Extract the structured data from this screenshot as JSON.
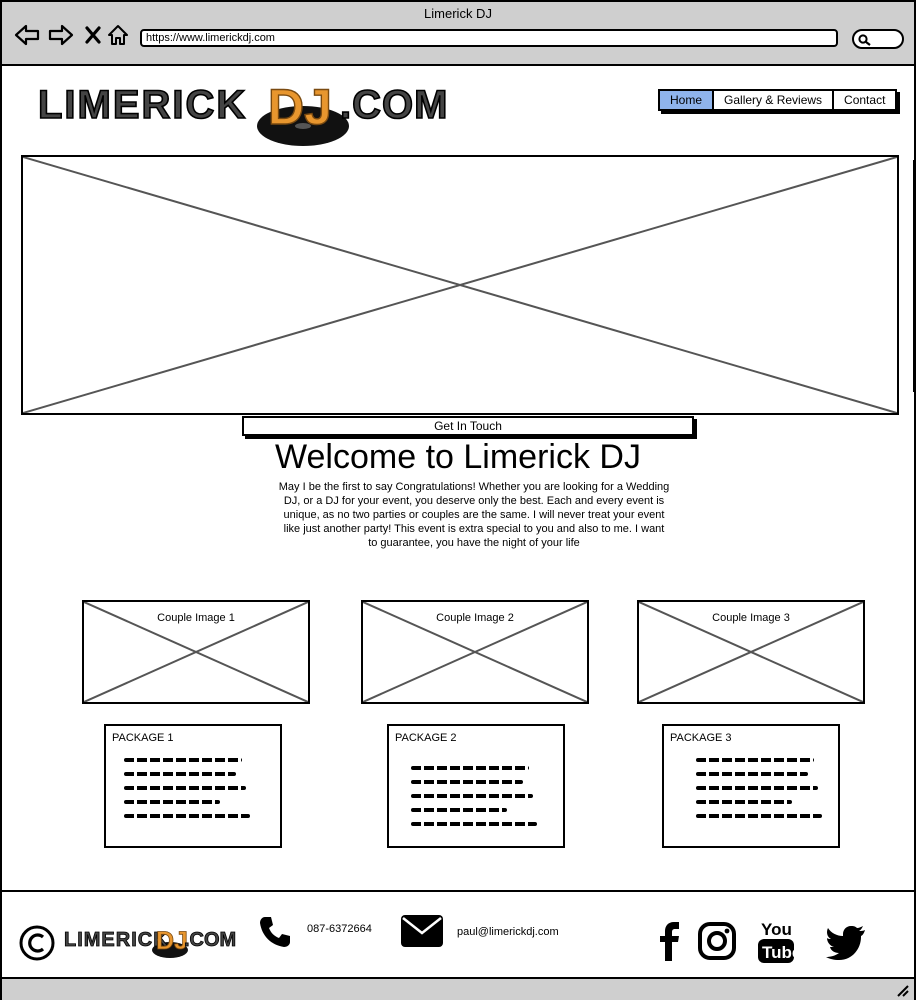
{
  "browser": {
    "window_title": "Limerick DJ",
    "url": "https://www.limerickdj.com"
  },
  "logo": {
    "left": "LIMERICK",
    "dj": "DJ",
    "right": ".COM"
  },
  "nav": {
    "items": [
      "Home",
      "Gallery & Reviews",
      "Contact"
    ],
    "active": "Home",
    "active_color": "#8fb4ec"
  },
  "hero": {
    "cta_label": "Get In Touch"
  },
  "welcome": {
    "title": "Welcome to Limerick DJ",
    "body": "May I be the first to say Congratulations! Whether you are looking for a Wedding DJ, or a DJ for your event, you deserve only the best. Each and every event is unique, as no two parties or couples are the same.  I will never treat your event like just another party! This event is extra special to you and also to me. I want to guarantee, you have the night of your life"
  },
  "couple_images": [
    "Couple Image 1",
    "Couple Image 2",
    "Couple Image 3"
  ],
  "packages": [
    "PACKAGE 1",
    "PACKAGE 2",
    "PACKAGE 3"
  ],
  "footer": {
    "phone": "087-6372664",
    "email": "paul@limerickdj.com",
    "social": [
      "facebook-icon",
      "instagram-icon",
      "youtube-icon",
      "twitter-icon"
    ]
  },
  "colors": {
    "frame_gray": "#cfcfcf",
    "logo_orange": "#e8962e"
  }
}
